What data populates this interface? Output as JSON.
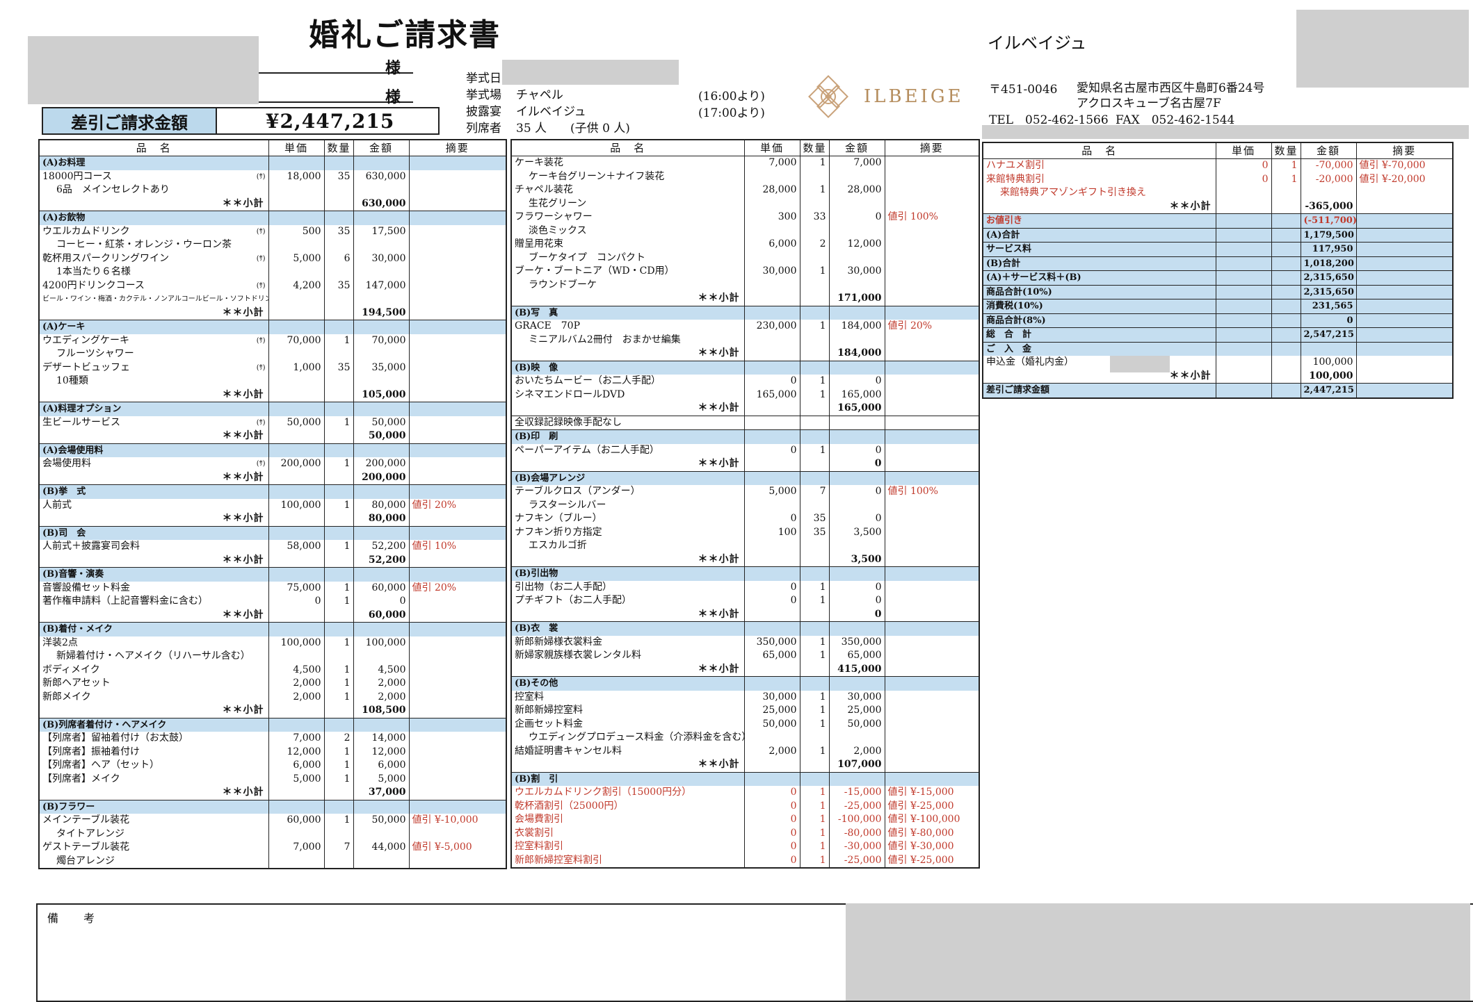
{
  "header": {
    "title": "婚礼ご請求書",
    "sama": [
      "様",
      "様"
    ],
    "amount_label": "差引ご請求金額",
    "amount_value": "¥2,447,215",
    "ceremony_date_label": "挙式日",
    "venue_label": "挙式場",
    "venue": "チャペル",
    "venue_time": "(16:00より)",
    "reception_label": "披露宴",
    "reception": "イルベイジュ",
    "reception_time": "(17:00より)",
    "guests_label": "列席者",
    "guests": "35 人　　(子供 0 人)"
  },
  "company": {
    "name": "イルベイジュ",
    "logo_text": "ILBEIGE",
    "postal": "〒451-0046",
    "address1": "愛知県名古屋市西区牛島町6番24号",
    "address2": "アクロスキューブ名古屋7F",
    "tel": "TEL　052-462-1566",
    "fax": "FAX　052-462-1544"
  },
  "columns": [
    "品　名",
    "単価",
    "数量",
    "金額",
    "摘要"
  ],
  "col1": [
    {
      "t": "sec",
      "name": "(A)お料理"
    },
    {
      "t": "item",
      "name": "18000円コース",
      "tag": "(ｻ)",
      "price": "18,000",
      "qty": "35",
      "amount": "630,000"
    },
    {
      "t": "note",
      "name": "6品　メインセレクトあり"
    },
    {
      "t": "sub",
      "name": "＊＊小計",
      "amount": "630,000"
    },
    {
      "t": "sec",
      "name": "(A)お飲物"
    },
    {
      "t": "item",
      "name": "ウエルカムドリンク",
      "tag": "(ｻ)",
      "price": "500",
      "qty": "35",
      "amount": "17,500"
    },
    {
      "t": "note",
      "name": "コーヒー・紅茶・オレンジ・ウーロン茶"
    },
    {
      "t": "item",
      "name": "乾杯用スパークリングワイン",
      "tag": "(ｻ)",
      "price": "5,000",
      "qty": "6",
      "amount": "30,000"
    },
    {
      "t": "note",
      "name": "1本当たり６名様"
    },
    {
      "t": "item",
      "name": "4200円ドリンクコース",
      "tag": "(ｻ)",
      "price": "4,200",
      "qty": "35",
      "amount": "147,000"
    },
    {
      "t": "small",
      "name": "ビール・ワイン・梅酒・カクテル・ノンアルコールビール・ソフトドリンク・ノンアルコールカクテル（左記以外後日追加請求）"
    },
    {
      "t": "sub",
      "name": "＊＊小計",
      "amount": "194,500"
    },
    {
      "t": "sec",
      "name": "(A)ケーキ"
    },
    {
      "t": "item",
      "name": "ウエディングケーキ",
      "tag": "(ｻ)",
      "price": "70,000",
      "qty": "1",
      "amount": "70,000"
    },
    {
      "t": "note",
      "name": "フルーツシャワー"
    },
    {
      "t": "item",
      "name": "デザートビュッフェ",
      "tag": "(ｻ)",
      "price": "1,000",
      "qty": "35",
      "amount": "35,000"
    },
    {
      "t": "note",
      "name": "10種類"
    },
    {
      "t": "sub",
      "name": "＊＊小計",
      "amount": "105,000"
    },
    {
      "t": "sec",
      "name": "(A)料理オプション"
    },
    {
      "t": "item",
      "name": "生ビールサービス",
      "tag": "(ｻ)",
      "price": "50,000",
      "qty": "1",
      "amount": "50,000"
    },
    {
      "t": "sub",
      "name": "＊＊小計",
      "amount": "50,000"
    },
    {
      "t": "sec",
      "name": "(A)会場使用料"
    },
    {
      "t": "item",
      "name": "会場使用料",
      "tag": "(ｻ)",
      "price": "200,000",
      "qty": "1",
      "amount": "200,000"
    },
    {
      "t": "sub",
      "name": "＊＊小計",
      "amount": "200,000"
    },
    {
      "t": "sec",
      "name": "(B)挙　式"
    },
    {
      "t": "item",
      "name": "人前式",
      "price": "100,000",
      "qty": "1",
      "amount": "80,000",
      "memo": "値引 20%"
    },
    {
      "t": "sub",
      "name": "＊＊小計",
      "amount": "80,000"
    },
    {
      "t": "sec",
      "name": "(B)司　会"
    },
    {
      "t": "item",
      "name": "人前式＋披露宴司会料",
      "price": "58,000",
      "qty": "1",
      "amount": "52,200",
      "memo": "値引 10%"
    },
    {
      "t": "sub",
      "name": "＊＊小計",
      "amount": "52,200"
    },
    {
      "t": "sec",
      "name": "(B)音響・演奏"
    },
    {
      "t": "item",
      "name": "音響設備セット料金",
      "price": "75,000",
      "qty": "1",
      "amount": "60,000",
      "memo": "値引 20%"
    },
    {
      "t": "item",
      "name": "著作権申請料（上記音響料金に含む）",
      "price": "0",
      "qty": "1",
      "amount": "0"
    },
    {
      "t": "sub",
      "name": "＊＊小計",
      "amount": "60,000"
    },
    {
      "t": "sec",
      "name": "(B)着付・メイク"
    },
    {
      "t": "item",
      "name": "洋装2点",
      "price": "100,000",
      "qty": "1",
      "amount": "100,000"
    },
    {
      "t": "note",
      "name": "新婦着付け・ヘアメイク（リハーサル含む）"
    },
    {
      "t": "item",
      "name": "ボディメイク",
      "price": "4,500",
      "qty": "1",
      "amount": "4,500"
    },
    {
      "t": "item",
      "name": "新郎ヘアセット",
      "price": "2,000",
      "qty": "1",
      "amount": "2,000"
    },
    {
      "t": "item",
      "name": "新郎メイク",
      "price": "2,000",
      "qty": "1",
      "amount": "2,000"
    },
    {
      "t": "sub",
      "name": "＊＊小計",
      "amount": "108,500"
    },
    {
      "t": "sec",
      "name": "(B)列席者着付け・ヘアメイク"
    },
    {
      "t": "item",
      "name": "【列席者】留袖着付け（お太鼓）",
      "price": "7,000",
      "qty": "2",
      "amount": "14,000"
    },
    {
      "t": "item",
      "name": "【列席者】振袖着付け",
      "price": "12,000",
      "qty": "1",
      "amount": "12,000"
    },
    {
      "t": "item",
      "name": "【列席者】ヘア（セット）",
      "price": "6,000",
      "qty": "1",
      "amount": "6,000"
    },
    {
      "t": "item",
      "name": "【列席者】メイク",
      "price": "5,000",
      "qty": "1",
      "amount": "5,000"
    },
    {
      "t": "sub",
      "name": "＊＊小計",
      "amount": "37,000"
    },
    {
      "t": "sec",
      "name": "(B)フラワー"
    },
    {
      "t": "item",
      "name": "メインテーブル装花",
      "price": "60,000",
      "qty": "1",
      "amount": "50,000",
      "memo": "値引 ¥-10,000"
    },
    {
      "t": "note",
      "name": "タイトアレンジ"
    },
    {
      "t": "item",
      "name": "ゲストテーブル装花",
      "price": "7,000",
      "qty": "7",
      "amount": "44,000",
      "memo": "値引 ¥-5,000"
    },
    {
      "t": "note",
      "name": "燭台アレンジ"
    }
  ],
  "col2": [
    {
      "t": "item",
      "name": "ケーキ装花",
      "price": "7,000",
      "qty": "1",
      "amount": "7,000"
    },
    {
      "t": "note",
      "name": "ケーキ台グリーン＋ナイフ装花"
    },
    {
      "t": "item",
      "name": "チャペル装花",
      "price": "28,000",
      "qty": "1",
      "amount": "28,000"
    },
    {
      "t": "note",
      "name": "生花グリーン"
    },
    {
      "t": "item",
      "name": "フラワーシャワー",
      "price": "300",
      "qty": "33",
      "amount": "0",
      "memo": "値引 100%"
    },
    {
      "t": "note",
      "name": "淡色ミックス"
    },
    {
      "t": "item",
      "name": "贈呈用花束",
      "price": "6,000",
      "qty": "2",
      "amount": "12,000"
    },
    {
      "t": "note",
      "name": "ブーケタイプ　コンパクト"
    },
    {
      "t": "item",
      "name": "ブーケ・ブートニア（WD・CD用）",
      "price": "30,000",
      "qty": "1",
      "amount": "30,000"
    },
    {
      "t": "note",
      "name": "ラウンドブーケ"
    },
    {
      "t": "sub",
      "name": "＊＊小計",
      "amount": "171,000"
    },
    {
      "t": "sec",
      "name": "(B)写　真"
    },
    {
      "t": "item",
      "name": "GRACE　70P",
      "price": "230,000",
      "qty": "1",
      "amount": "184,000",
      "memo": "値引 20%"
    },
    {
      "t": "note",
      "name": "ミニアルバム2冊付　おまかせ編集"
    },
    {
      "t": "sub",
      "name": "＊＊小計",
      "amount": "184,000"
    },
    {
      "t": "sec",
      "name": "(B)映　像"
    },
    {
      "t": "item",
      "name": "おいたちムービー（お二人手配）",
      "price": "0",
      "qty": "1",
      "amount": "0"
    },
    {
      "t": "item",
      "name": "シネマエンドロールDVD",
      "price": "165,000",
      "qty": "1",
      "amount": "165,000"
    },
    {
      "t": "sub",
      "name": "＊＊小計",
      "amount": "165,000"
    },
    {
      "t": "plain",
      "name": "全収録記録映像手配なし"
    },
    {
      "t": "sec",
      "name": "(B)印　刷"
    },
    {
      "t": "item",
      "name": "ペーパーアイテム（お二人手配）",
      "price": "0",
      "qty": "1",
      "amount": "0"
    },
    {
      "t": "sub",
      "name": "＊＊小計",
      "amount": "0"
    },
    {
      "t": "sec",
      "name": "(B)会場アレンジ"
    },
    {
      "t": "item",
      "name": "テーブルクロス（アンダー）",
      "price": "5,000",
      "qty": "7",
      "amount": "0",
      "memo": "値引 100%"
    },
    {
      "t": "note",
      "name": "ラスターシルバー"
    },
    {
      "t": "item",
      "name": "ナフキン（ブルー）",
      "price": "0",
      "qty": "35",
      "amount": "0"
    },
    {
      "t": "item",
      "name": "ナフキン折り方指定",
      "price": "100",
      "qty": "35",
      "amount": "3,500"
    },
    {
      "t": "note",
      "name": "エスカルゴ折"
    },
    {
      "t": "sub",
      "name": "＊＊小計",
      "amount": "3,500"
    },
    {
      "t": "sec",
      "name": "(B)引出物"
    },
    {
      "t": "item",
      "name": "引出物（お二人手配）",
      "price": "0",
      "qty": "1",
      "amount": "0"
    },
    {
      "t": "item",
      "name": "プチギフト（お二人手配）",
      "price": "0",
      "qty": "1",
      "amount": "0"
    },
    {
      "t": "sub",
      "name": "＊＊小計",
      "amount": "0"
    },
    {
      "t": "sec",
      "name": "(B)衣　裳"
    },
    {
      "t": "item",
      "name": "新郎新婦様衣裳料金",
      "price": "350,000",
      "qty": "1",
      "amount": "350,000"
    },
    {
      "t": "item",
      "name": "新婦家親族様衣裳レンタル料",
      "price": "65,000",
      "qty": "1",
      "amount": "65,000"
    },
    {
      "t": "sub",
      "name": "＊＊小計",
      "amount": "415,000"
    },
    {
      "t": "sec",
      "name": "(B)その他"
    },
    {
      "t": "item",
      "name": "控室料",
      "price": "30,000",
      "qty": "1",
      "amount": "30,000"
    },
    {
      "t": "item",
      "name": "新郎新婦控室料",
      "price": "25,000",
      "qty": "1",
      "amount": "25,000"
    },
    {
      "t": "item",
      "name": "企画セット料金",
      "price": "50,000",
      "qty": "1",
      "amount": "50,000"
    },
    {
      "t": "note",
      "name": "ウエディングプロデュース料金（介添料金を含む）"
    },
    {
      "t": "item",
      "name": "結婚証明書キャンセル料",
      "price": "2,000",
      "qty": "1",
      "amount": "2,000"
    },
    {
      "t": "sub",
      "name": "＊＊小計",
      "amount": "107,000"
    },
    {
      "t": "sec",
      "name": "(B)割　引"
    },
    {
      "t": "red",
      "name": "ウエルカムドリンク割引（15000円分）",
      "price": "0",
      "qty": "1",
      "amount": "-15,000",
      "memo": "値引 ¥-15,000"
    },
    {
      "t": "red",
      "name": "乾杯酒割引（25000円）",
      "price": "0",
      "qty": "1",
      "amount": "-25,000",
      "memo": "値引 ¥-25,000"
    },
    {
      "t": "red",
      "name": "会場費割引",
      "price": "0",
      "qty": "1",
      "amount": "-100,000",
      "memo": "値引 ¥-100,000"
    },
    {
      "t": "red",
      "name": "衣裳割引",
      "price": "0",
      "qty": "1",
      "amount": "-80,000",
      "memo": "値引 ¥-80,000"
    },
    {
      "t": "red",
      "name": "控室料割引",
      "price": "0",
      "qty": "1",
      "amount": "-30,000",
      "memo": "値引 ¥-30,000"
    },
    {
      "t": "red",
      "name": "新郎新婦控室料割引",
      "price": "0",
      "qty": "1",
      "amount": "-25,000",
      "memo": "値引 ¥-25,000"
    }
  ],
  "col3": [
    {
      "t": "red",
      "name": "ハナユメ割引",
      "price": "0",
      "qty": "1",
      "amount": "-70,000",
      "memo": "値引 ¥-70,000"
    },
    {
      "t": "red",
      "name": "来館特典割引",
      "price": "0",
      "qty": "1",
      "amount": "-20,000",
      "memo": "値引 ¥-20,000"
    },
    {
      "t": "rednote",
      "name": "来館特典アマゾンギフト引き換え"
    },
    {
      "t": "sub",
      "name": "＊＊小計",
      "amount": "-365,000"
    },
    {
      "t": "sumred",
      "name": "お値引き",
      "amount": "(-511,700)"
    },
    {
      "t": "sum",
      "name": "(A)合計",
      "amount": "1,179,500"
    },
    {
      "t": "sum",
      "name": "サービス料",
      "amount": "117,950"
    },
    {
      "t": "sum",
      "name": "(B)合計",
      "amount": "1,018,200"
    },
    {
      "t": "sum",
      "name": "(A)＋サービス料＋(B)",
      "amount": "2,315,650"
    },
    {
      "t": "sum",
      "name": "商品合計(10%)",
      "amount": "2,315,650"
    },
    {
      "t": "sum",
      "name": "消費税(10%)",
      "amount": "231,565"
    },
    {
      "t": "sum",
      "name": "商品合計(8%)",
      "amount": "0"
    },
    {
      "t": "sum",
      "name": "総　合　計",
      "amount": "2,547,215"
    },
    {
      "t": "sum",
      "name": "ご　入　金",
      "amount": ""
    },
    {
      "t": "item",
      "name": "申込金（婚礼内金）",
      "price": "",
      "qty": "",
      "amount": "100,000"
    },
    {
      "t": "sub",
      "name": "＊＊小計",
      "amount": "100,000"
    },
    {
      "t": "sum",
      "name": "差引ご請求金額",
      "amount": "2,447,215"
    }
  ],
  "remarks_label": "備　考"
}
